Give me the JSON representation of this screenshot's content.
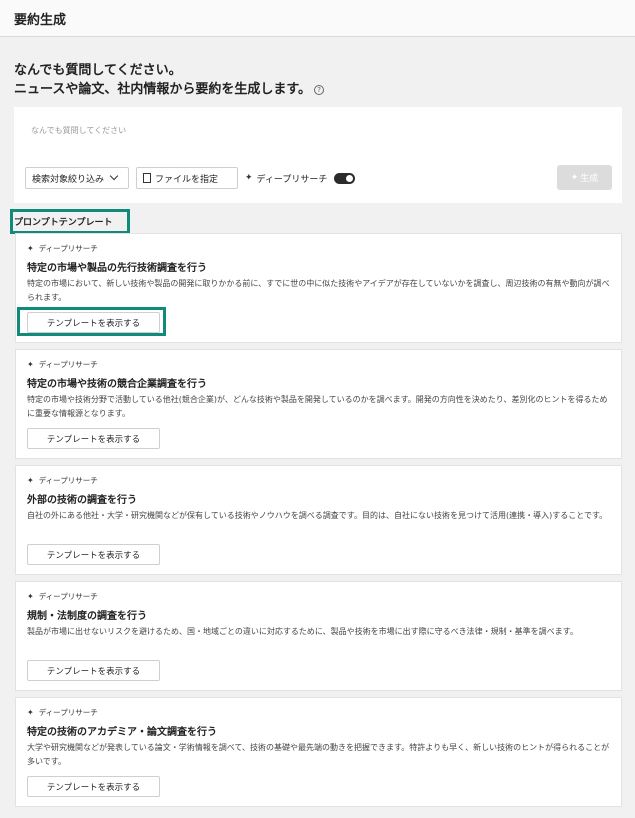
{
  "app": {
    "title": "要約生成"
  },
  "heading": {
    "line1": "なんでも質問してください。",
    "line2": "ニュースや論文、社内情報から要約を生成します。",
    "help_icon": "question-circle-icon"
  },
  "query": {
    "placeholder": "なんでも質問してください",
    "scope_label": "検索対象絞り込み",
    "file_label": "ファイルを指定",
    "deep_research_label": "ディープリサーチ",
    "deep_research_enabled": true,
    "generate_label": "生成"
  },
  "templates": {
    "section_label": "プロンプトテンプレート",
    "show_label": "テンプレートを表示する",
    "items": [
      {
        "badge": "ディープリサーチ",
        "title": "特定の市場や製品の先行技術調査を行う",
        "description": "特定の市場において、新しい技術や製品の開発に取りかかる前に、すでに世の中に似た技術やアイデアが存在していないかを調査し、周辺技術の有無や動向が調べられます。"
      },
      {
        "badge": "ディープリサーチ",
        "title": "特定の市場や技術の競合企業調査を行う",
        "description": "特定の市場や技術分野で活動している他社(競合企業)が、どんな技術や製品を開発しているのかを調べます。開発の方向性を決めたり、差別化のヒントを得るために重要な情報源となります。"
      },
      {
        "badge": "ディープリサーチ",
        "title": "外部の技術の調査を行う",
        "description": "自社の外にある他社・大学・研究機関などが保有している技術やノウハウを調べる調査です。目的は、自社にない技術を見つけて活用(連携・導入)することです。"
      },
      {
        "badge": "ディープリサーチ",
        "title": "規制・法制度の調査を行う",
        "description": "製品が市場に出せないリスクを避けるため、国・地域ごとの違いに対応するために、製品や技術を市場に出す際に守るべき法律・規制・基準を調べます。"
      },
      {
        "badge": "ディープリサーチ",
        "title": "特定の技術のアカデミア・論文調査を行う",
        "description": "大学や研究機関などが発表している論文・学術情報を調べて、技術の基礎や最先端の動きを把握できます。特許よりも早く、新しい技術のヒントが得られることが多いです。"
      }
    ]
  },
  "colors": {
    "highlight": "#128a7a",
    "background": "#f1f1f1"
  }
}
